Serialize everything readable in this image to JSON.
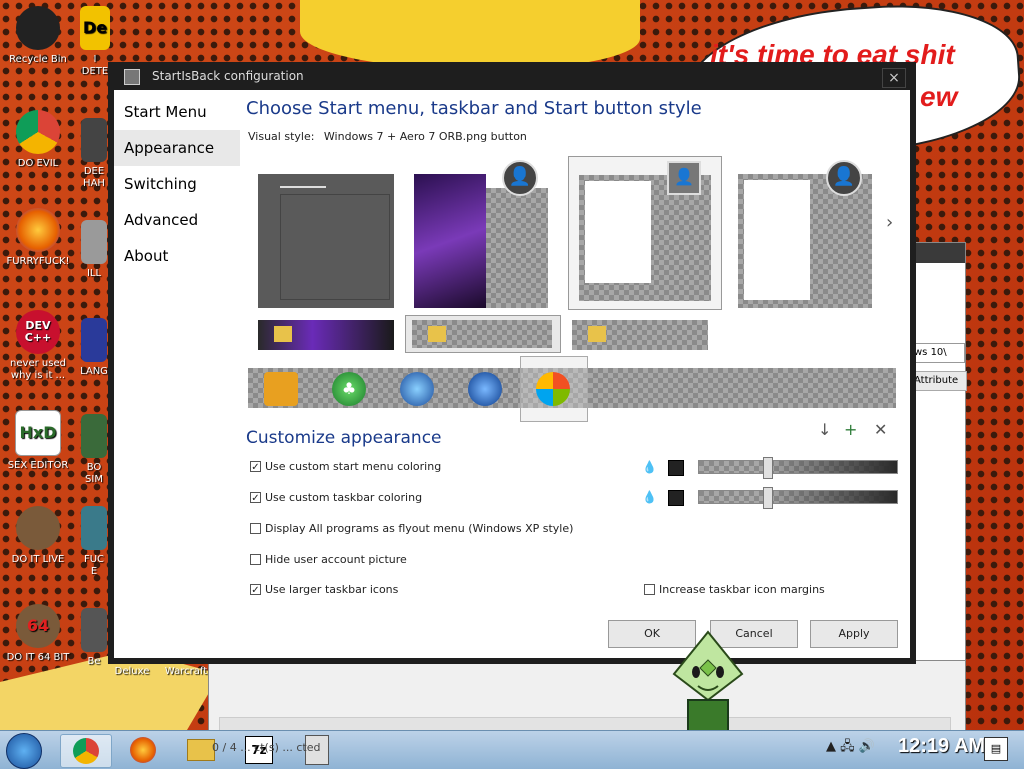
{
  "wallpaper": {
    "speech_bubble": [
      "it's time to eat shit",
      "ew"
    ]
  },
  "desktop_icons": [
    {
      "label": "Recycle Bin",
      "label2": "",
      "icon": "recycle-bin-icon",
      "color": "#222222"
    },
    {
      "label": "DO EVIL",
      "label2": "",
      "icon": "chrome-icon",
      "color": "#2a7ae2"
    },
    {
      "label": "FURRYFUCK!",
      "label2": "",
      "icon": "firefox-icon",
      "color": "#e66000"
    },
    {
      "label": "never used",
      "label2": "why is it ...",
      "icon": "dev-cpp-icon",
      "color": "#c8102e",
      "text": "DEV C++"
    },
    {
      "label": "SEX EDITOR",
      "label2": "",
      "icon": "hxd-icon",
      "color": "#ffffff",
      "text": "HxD"
    },
    {
      "label": "DO IT LIVE",
      "label2": "",
      "icon": "portrait-icon",
      "color": "#7a5a3a"
    },
    {
      "label": "DO IT 64 BIT",
      "label2": "",
      "icon": "portrait-64-icon",
      "color": "#7a5a3a",
      "text": "64"
    }
  ],
  "desktop_icons_col2": [
    {
      "label": "I",
      "label2": "DETE",
      "icon": "de-app-icon",
      "text": "De"
    },
    {
      "label": "DEE",
      "label2": "HAH",
      "icon": "app-icon"
    },
    {
      "label": "ILL",
      "label2": "",
      "icon": "app-icon"
    },
    {
      "label": "LANG",
      "label2": "",
      "icon": "app-icon"
    },
    {
      "label": "BO",
      "label2": "SIM",
      "icon": "app-icon"
    },
    {
      "label": "FUC",
      "label2": "E",
      "icon": "app-icon"
    },
    {
      "label": "Be",
      "label2": "",
      "icon": "app-icon"
    }
  ],
  "bottom_desktop_labels": [
    "Deluxe",
    "Warcraft"
  ],
  "background_window": {
    "select_value": "ws 10\\",
    "button": "Attribute"
  },
  "dialog": {
    "title": "StartIsBack configuration",
    "close": "×",
    "sidebar": [
      {
        "label": "Start Menu",
        "active": false
      },
      {
        "label": "Appearance",
        "active": true
      },
      {
        "label": "Switching",
        "active": false
      },
      {
        "label": "Advanced",
        "active": false
      },
      {
        "label": "About",
        "active": false
      }
    ],
    "heading": "Choose Start menu, taskbar and Start button style",
    "visual_style_label": "Visual style:",
    "visual_style_value": "Windows 7 + Aero 7 ORB.png button",
    "next_arrow": "›",
    "customize_heading": "Customize appearance",
    "tools": [
      "↓",
      "+",
      "✕"
    ],
    "checkboxes": [
      {
        "label": "Use custom start menu coloring",
        "checked": true
      },
      {
        "label": "Use custom taskbar coloring",
        "checked": true
      },
      {
        "label": "Display All programs as flyout menu (Windows XP style)",
        "checked": false
      },
      {
        "label": "Hide user account picture",
        "checked": false
      },
      {
        "label": "Use larger taskbar icons",
        "checked": true
      },
      {
        "label": "Increase taskbar icon margins",
        "checked": false
      }
    ],
    "sliders": [
      {
        "name": "start-menu-transparency",
        "value": 0.3,
        "color": "#222222"
      },
      {
        "name": "taskbar-transparency",
        "value": 0.3,
        "color": "#222222"
      }
    ],
    "buttons": {
      "ok": "OK",
      "cancel": "Cancel",
      "apply": "Apply"
    }
  },
  "taskbar": {
    "status_text": "0 / 4 ... ct(s) ... cted",
    "clock": "12:19 AM",
    "apps": [
      "chrome",
      "firefox",
      "explorer",
      "7z",
      "notepad"
    ],
    "app_7z_label": "7z"
  }
}
